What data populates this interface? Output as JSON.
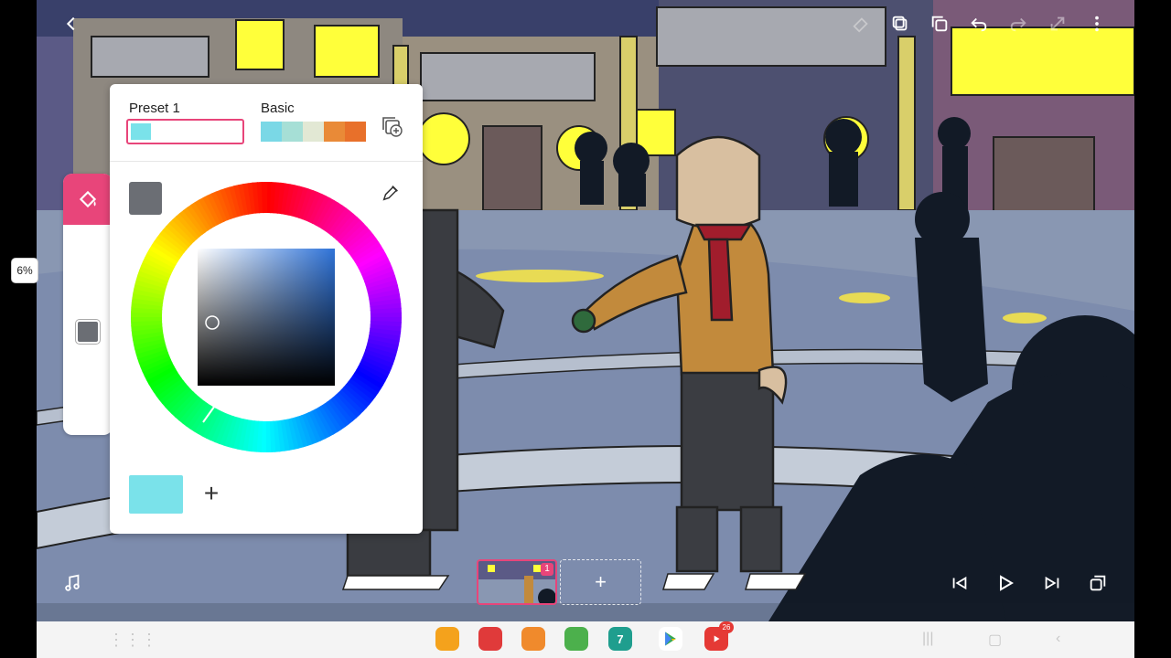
{
  "toolbar": {
    "back_icon": "chevron-left-icon",
    "icons": [
      "eraser-icon",
      "layers-icon",
      "duplicate-icon",
      "undo-icon",
      "redo-icon",
      "transform-icon",
      "more-icon"
    ]
  },
  "brush": {
    "size_label": "6%",
    "color": "#6b6e74"
  },
  "color_picker": {
    "preset_label": "Preset 1",
    "basic_label": "Basic",
    "preset_swatch": "#7ae2ea",
    "basic_swatches": [
      "#7ad8e6",
      "#a6dfd6",
      "#e2e8d4",
      "#e98a37",
      "#e8702a"
    ],
    "current_color": "#6b6e74",
    "selected_hue": "#2f73d8",
    "new_color": "#7ae2ea"
  },
  "timeline": {
    "frame_number": "1",
    "add_frame_label": "+"
  },
  "playback": {
    "icons": [
      "skip-start-icon",
      "play-icon",
      "skip-end-icon",
      "frames-icon"
    ]
  },
  "taskbar": {
    "apps": [
      {
        "name": "files-app-icon",
        "color": "#f4a21c"
      },
      {
        "name": "notes-app-icon",
        "color": "#e03a3a"
      },
      {
        "name": "contacts-app-icon",
        "color": "#f08a2c"
      },
      {
        "name": "calculator-app-icon",
        "color": "#4cb04c"
      },
      {
        "name": "calendar-app-icon",
        "color": "#1f9e8e"
      },
      {
        "name": "play-store-app-icon",
        "color": "#ffffff"
      },
      {
        "name": "youtube-app-icon",
        "color": "#e53935"
      }
    ],
    "calendar_day": "7",
    "youtube_badge": "26"
  }
}
